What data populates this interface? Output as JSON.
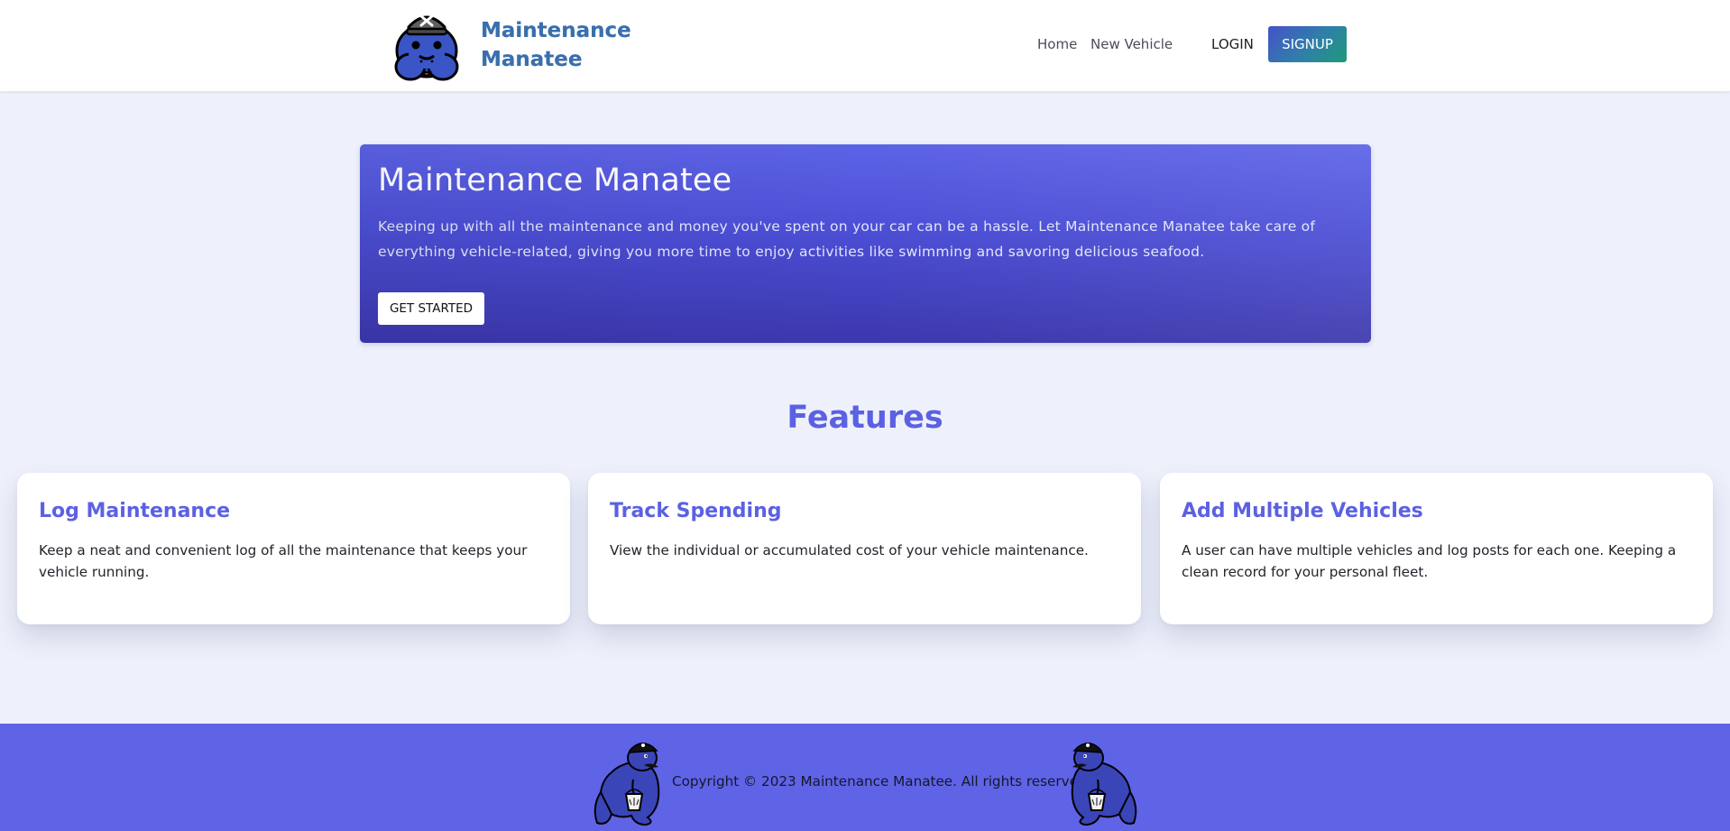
{
  "brand": {
    "line1": "Maintenance",
    "line2": "Manatee"
  },
  "nav": {
    "home": "Home",
    "new_vehicle": "New Vehicle",
    "login": "LOGIN",
    "signup": "SIGNUP"
  },
  "hero": {
    "title": "Maintenance Manatee",
    "text": "Keeping up with all the maintenance and money you've spent on your car can be a hassle. Let Maintenance Manatee take care of everything vehicle-related, giving you more time to enjoy activities like swimming and savoring delicious seafood.",
    "button": "GET STARTED"
  },
  "features": {
    "title": "Features",
    "cards": [
      {
        "title": "Log Maintenance",
        "text": "Keep a neat and convenient log of all the maintenance that keeps your vehicle running."
      },
      {
        "title": "Track Spending",
        "text": "View the individual or accumulated cost of your vehicle maintenance."
      },
      {
        "title": "Add Multiple Vehicles",
        "text": "A user can have multiple vehicles and log posts for each one. Keeping a clean record for your personal fleet."
      }
    ]
  },
  "footer": {
    "copyright": "Copyright © 2023 Maintenance Manatee. All rights reserved."
  },
  "icons": {
    "logo": "manatee-mechanic-logo",
    "footer_left": "manatee-bucket-mascot",
    "footer_right": "manatee-bucket-mascot"
  },
  "colors": {
    "page_background": "#eef1fb",
    "accent": "#5b61e2",
    "hero_gradient_top": "#5d63e6",
    "hero_gradient_bottom": "#3c37ad",
    "footer_background": "#5f63e6",
    "signup_gradient_start": "#4553c9",
    "signup_gradient_end": "#1f9a7a"
  }
}
